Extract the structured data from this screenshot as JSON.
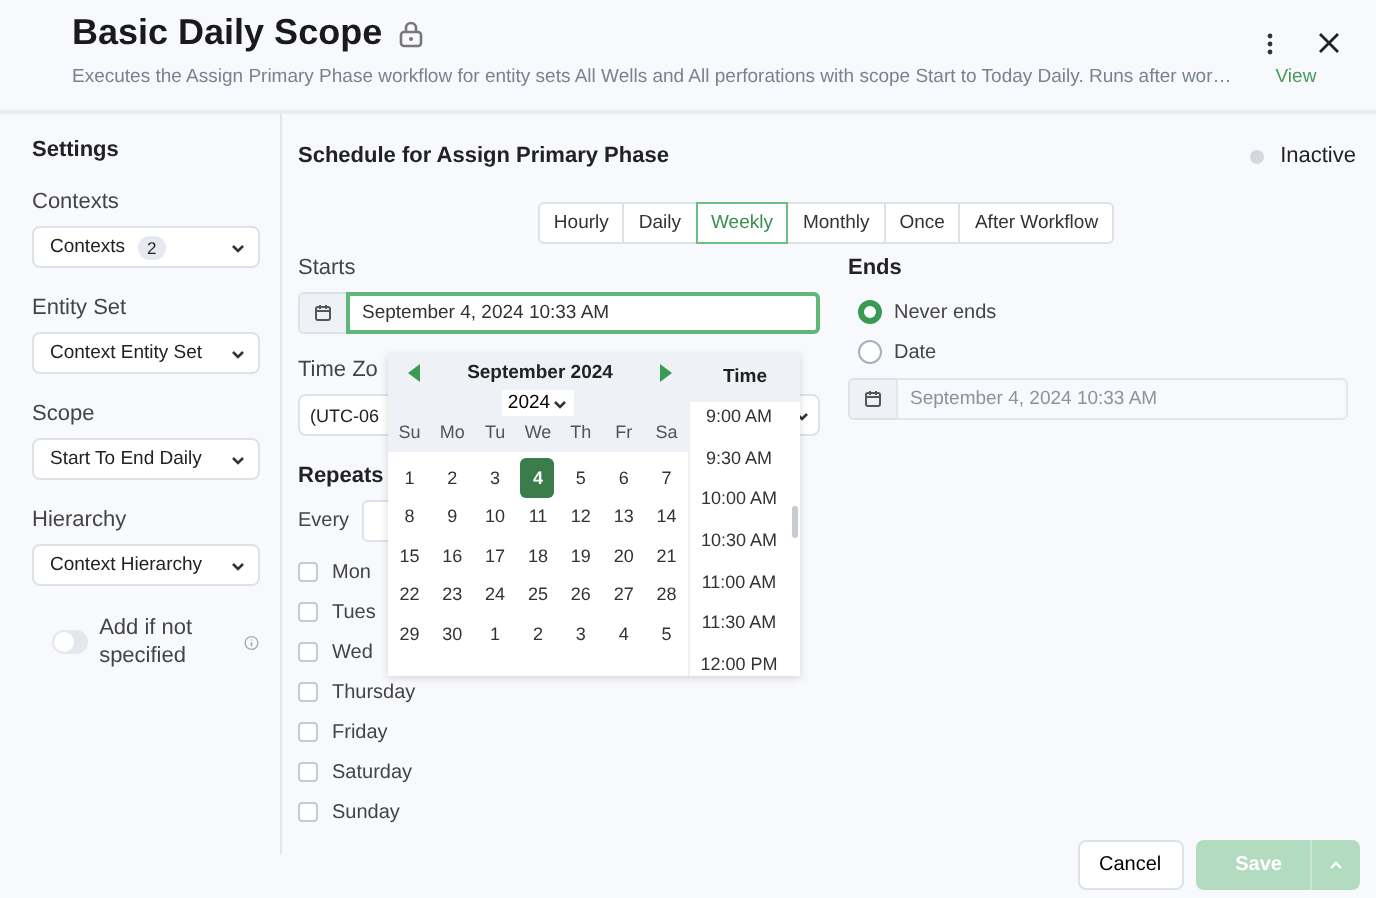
{
  "header": {
    "title": "Basic Daily Scope",
    "description": "Executes the Assign Primary Phase workflow for entity sets All Wells and All perforations with scope Start to Today Daily. Runs after wor…",
    "link": "View"
  },
  "sidebar": {
    "heading": "Settings",
    "fields": [
      {
        "label": "Contexts",
        "value": "Contexts",
        "badge": "2"
      },
      {
        "label": "Entity Set",
        "value": "Context Entity Set"
      },
      {
        "label": "Scope",
        "value": "Start To End Daily"
      },
      {
        "label": "Hierarchy",
        "value": "Context Hierarchy"
      }
    ],
    "toggle": {
      "label": "Add if not specified",
      "on": false
    }
  },
  "schedule": {
    "title": "Schedule for Assign Primary Phase",
    "status": {
      "label": "Inactive",
      "active": false
    },
    "frequencies": [
      {
        "label": "Hourly",
        "selected": false
      },
      {
        "label": "Daily",
        "selected": false
      },
      {
        "label": "Weekly",
        "selected": true
      },
      {
        "label": "Monthly",
        "selected": false
      },
      {
        "label": "Once",
        "selected": false
      },
      {
        "label": "After Workflow",
        "selected": false
      }
    ],
    "starts": {
      "label": "Starts",
      "value": "September 4, 2024 10:33 AM"
    },
    "time_zone": {
      "label": "Time Zo",
      "value": "(UTC-06"
    },
    "repeats": {
      "label": "Repeats",
      "every_label": "Every",
      "days": [
        {
          "label": "Mon",
          "checked": false
        },
        {
          "label": "Tues",
          "checked": false
        },
        {
          "label": "Wed",
          "checked": false
        },
        {
          "label": "Thursday",
          "checked": false
        },
        {
          "label": "Friday",
          "checked": false
        },
        {
          "label": "Saturday",
          "checked": false
        },
        {
          "label": "Sunday",
          "checked": false
        }
      ]
    },
    "ends": {
      "label": "Ends",
      "options": [
        {
          "label": "Never ends",
          "selected": true
        },
        {
          "label": "Date",
          "selected": false
        }
      ],
      "date": {
        "value": "September 4, 2024 10:33 AM",
        "disabled": true
      }
    }
  },
  "datepicker": {
    "month": "September 2024",
    "year": "2024",
    "weekdays": [
      "Su",
      "Mo",
      "Tu",
      "We",
      "Th",
      "Fr",
      "Sa"
    ],
    "days": [
      {
        "label": "1",
        "selected": false
      },
      {
        "label": "2",
        "selected": false
      },
      {
        "label": "3",
        "selected": false
      },
      {
        "label": "4",
        "selected": true
      },
      {
        "label": "5",
        "selected": false
      },
      {
        "label": "6",
        "selected": false
      },
      {
        "label": "7",
        "selected": false
      },
      {
        "label": "8",
        "selected": false
      },
      {
        "label": "9",
        "selected": false
      },
      {
        "label": "10",
        "selected": false
      },
      {
        "label": "11",
        "selected": false
      },
      {
        "label": "12",
        "selected": false
      },
      {
        "label": "13",
        "selected": false
      },
      {
        "label": "14",
        "selected": false
      },
      {
        "label": "15",
        "selected": false
      },
      {
        "label": "16",
        "selected": false
      },
      {
        "label": "17",
        "selected": false
      },
      {
        "label": "18",
        "selected": false
      },
      {
        "label": "19",
        "selected": false
      },
      {
        "label": "20",
        "selected": false
      },
      {
        "label": "21",
        "selected": false
      },
      {
        "label": "22",
        "selected": false
      },
      {
        "label": "23",
        "selected": false
      },
      {
        "label": "24",
        "selected": false
      },
      {
        "label": "25",
        "selected": false
      },
      {
        "label": "26",
        "selected": false
      },
      {
        "label": "27",
        "selected": false
      },
      {
        "label": "28",
        "selected": false
      },
      {
        "label": "29",
        "selected": false
      },
      {
        "label": "30",
        "selected": false
      },
      {
        "label": "1",
        "selected": false
      },
      {
        "label": "2",
        "selected": false
      },
      {
        "label": "3",
        "selected": false
      },
      {
        "label": "4",
        "selected": false
      },
      {
        "label": "5",
        "selected": false
      }
    ],
    "time_heading": "Time",
    "times": [
      "9:00 AM",
      "9:30 AM",
      "10:00 AM",
      "10:30 AM",
      "11:00 AM",
      "11:30 AM",
      "12:00 PM"
    ]
  },
  "buttons": {
    "cancel": "Cancel",
    "save": {
      "label": "Save",
      "disabled": true
    }
  }
}
